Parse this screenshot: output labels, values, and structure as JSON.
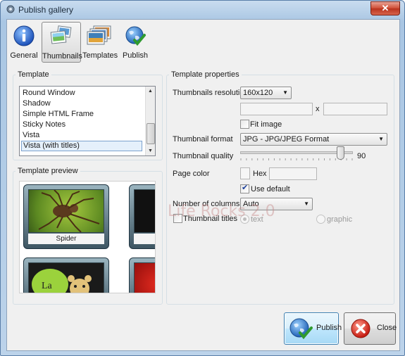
{
  "window": {
    "title": "Publish gallery",
    "close_glyph": "✕"
  },
  "toolbar": {
    "buttons": [
      {
        "label": "General",
        "icon": "info-icon"
      },
      {
        "label": "Thumbnails",
        "icon": "thumbnails-icon",
        "selected": true
      },
      {
        "label": "Templates",
        "icon": "templates-icon"
      },
      {
        "label": "Publish",
        "icon": "publish-globe-icon"
      }
    ]
  },
  "template": {
    "group_title": "Template",
    "items": [
      "Round Window",
      "Shadow",
      "Simple HTML Frame",
      "Sticky Notes",
      "Vista",
      "Vista (with titles)"
    ],
    "selected": "Vista (with titles)"
  },
  "preview": {
    "group_title": "Template preview",
    "thumbnails": [
      {
        "caption": "Spider"
      }
    ]
  },
  "properties": {
    "group_title": "Template properties",
    "thumb_resolution_label": "Thumbnails resolution",
    "thumb_resolution_value": "160x120",
    "size_separator": "x",
    "width_value": "",
    "height_value": "",
    "fit_image_label": "Fit image",
    "fit_image_checked": false,
    "format_label": "Thumbnail format",
    "format_value": "JPG - JPG/JPEG Format",
    "quality_label": "Thumbnail quality",
    "quality_value": "90",
    "quality_fraction": 0.9,
    "page_color_label": "Page color",
    "hex_label": "Hex",
    "hex_value": "",
    "use_default_label": "Use default",
    "use_default_checked": true,
    "columns_label": "Number of columns",
    "columns_value": "Auto",
    "titles_label": "Thumbnail titles",
    "titles_checked": false,
    "title_mode_text": "text",
    "title_mode_graphic": "graphic",
    "title_mode_selected": "text"
  },
  "buttons": {
    "publish": "Publish",
    "close": "Close"
  },
  "watermark": "Life Rocks 2.0",
  "colors": {
    "accent": "#3c7fb1",
    "close_red": "#cf4b33",
    "selection": "#e5f0fb"
  }
}
